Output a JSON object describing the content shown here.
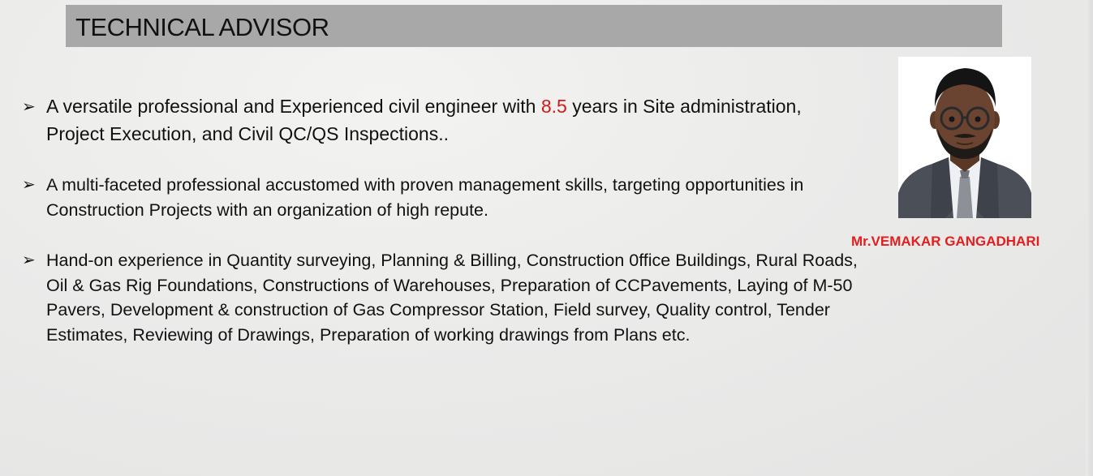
{
  "title": "TECHNICAL ADVISOR",
  "bullet_marker": "➢",
  "bullets": [
    {
      "before": "A versatile professional and Experienced civil engineer with ",
      "highlight": "8.5",
      "after": " years in Site administration, Project Execution, and Civil QC/QS Inspections.."
    },
    {
      "text": " A multi-faceted professional accustomed with proven management skills, targeting opportunities in Construction Projects with an organization of high repute."
    },
    {
      "text": "Hand-on experience in Quantity surveying, Planning & Billing, Construction 0ffice Buildings, Rural Roads, Oil & Gas Rig Foundations, Constructions of Warehouses, Preparation of CCPavements, Laying of M-50 Pavers, Development & construction of Gas Compressor Station, Field survey, Quality control, Tender Estimates, Reviewing of Drawings, Preparation of working drawings from Plans etc."
    }
  ],
  "profile": {
    "name": "Mr.VEMAKAR GANGADHARI"
  },
  "colors": {
    "title_bar": "#a8a8a8",
    "highlight": "#d21a1a",
    "name": "#e31e1e"
  }
}
